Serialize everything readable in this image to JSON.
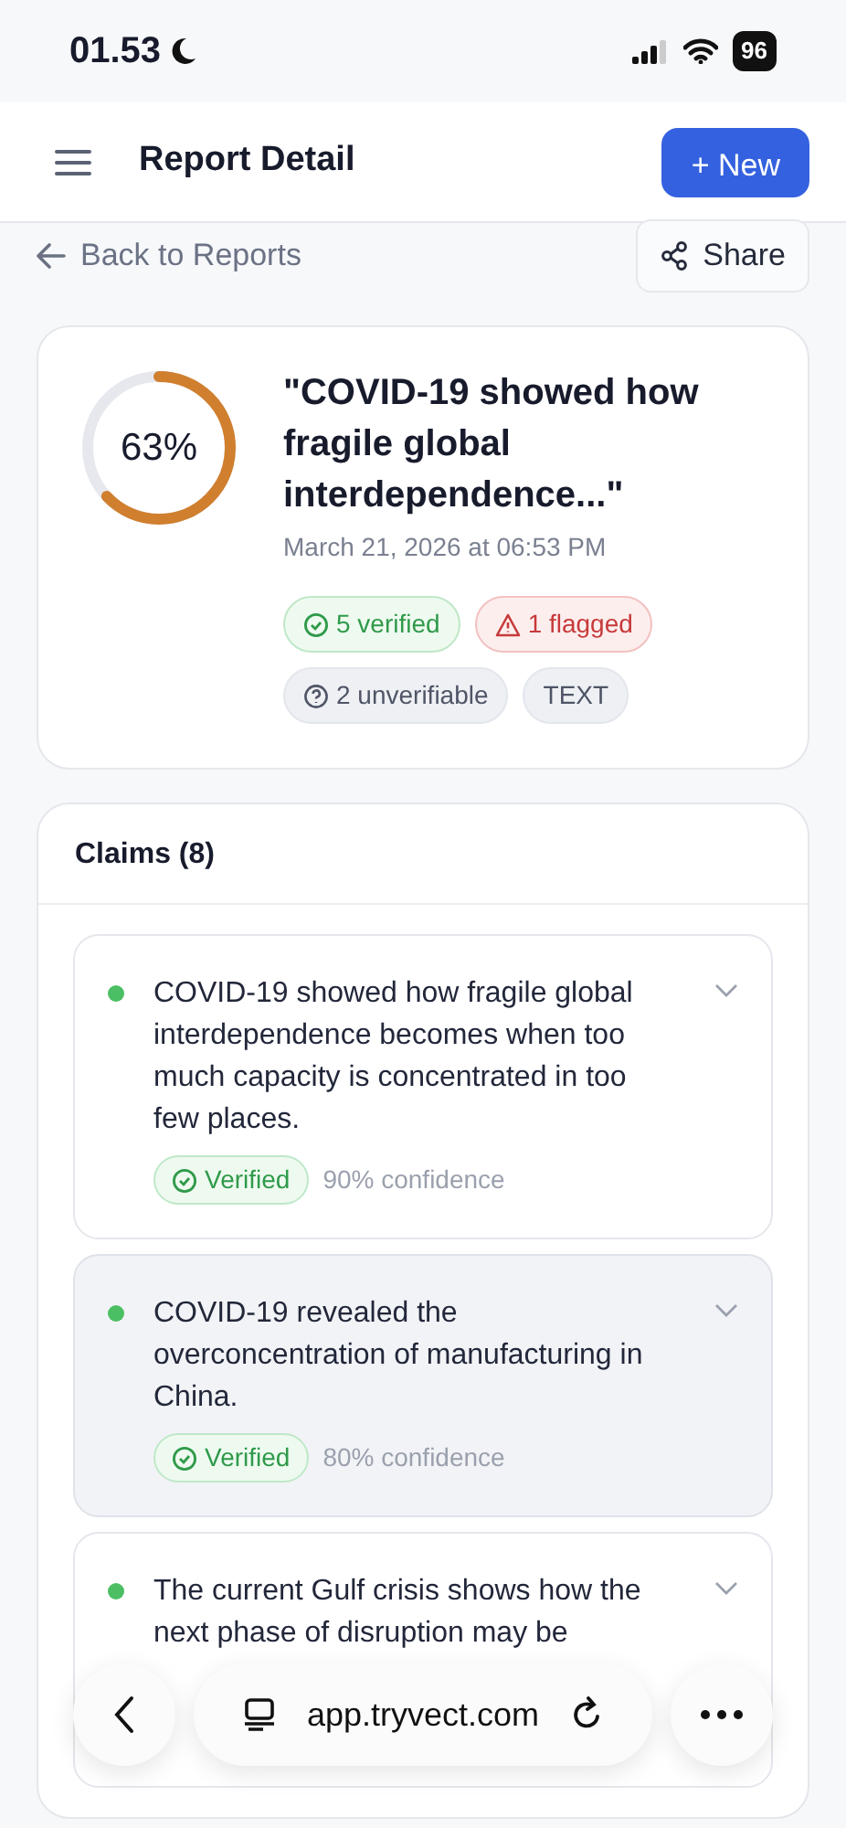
{
  "status_bar": {
    "time": "01.53",
    "battery": "96"
  },
  "header": {
    "title": "Report Detail",
    "new_button": "+ New"
  },
  "back_link": "Back to Reports",
  "share_button": "Share",
  "summary": {
    "score": "63%",
    "level": 0.63,
    "color": "#d07f2e",
    "title": "\"COVID-19 showed how fragile global interdependence...\"",
    "date": "March 21, 2026 at 06:53 PM",
    "tags": [
      {
        "kind": "verified",
        "label": "5 verified"
      },
      {
        "kind": "flagged",
        "label": "1 flagged"
      },
      {
        "kind": "unverifiable",
        "label": "2 unverifiable"
      },
      {
        "kind": "plain",
        "label": "TEXT"
      }
    ]
  },
  "claims": {
    "title": "Claims (8)",
    "items": [
      {
        "text": "COVID-19 showed how fragile global interdependence becomes when too much capacity is concentrated in too few places.",
        "color": "#4cbf64",
        "status": {
          "kind": "verified",
          "label": "Verified"
        },
        "confidence": "90% confidence",
        "expanded": false,
        "selected": false
      },
      {
        "text": "COVID-19 revealed the overconcentration of manufacturing in China.",
        "color": "#4cbf64",
        "status": {
          "kind": "verified",
          "label": "Verified"
        },
        "confidence": "80% confidence",
        "expanded": false,
        "selected": true
      },
      {
        "text": "The current Gulf crisis shows how the next phase of disruption may be",
        "color": "#4cbf64",
        "expanded": false,
        "selected": false
      }
    ]
  },
  "browser_bar": {
    "url": "app.tryvect.com"
  }
}
